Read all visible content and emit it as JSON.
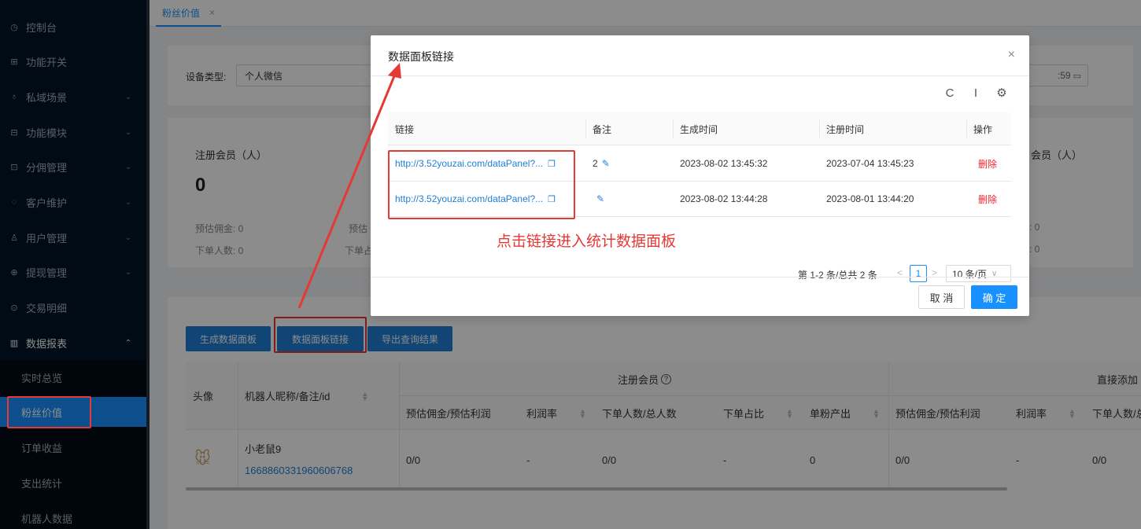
{
  "sidebar": {
    "items": [
      {
        "icon": "dashboard-icon",
        "glyph": "◷",
        "label": "控制台",
        "arrow": ""
      },
      {
        "icon": "switch-icon",
        "glyph": "⊞",
        "label": "功能开关",
        "arrow": ""
      },
      {
        "icon": "scene-icon",
        "glyph": "♁",
        "label": "私域场景",
        "arrow": "⌄"
      },
      {
        "icon": "module-icon",
        "glyph": "⊟",
        "label": "功能模块",
        "arrow": "⌄"
      },
      {
        "icon": "commission-icon",
        "glyph": "⊡",
        "label": "分佣管理",
        "arrow": "⌄"
      },
      {
        "icon": "customer-icon",
        "glyph": "◌",
        "label": "客户维护",
        "arrow": "⌄"
      },
      {
        "icon": "user-icon",
        "glyph": "♙",
        "label": "用户管理",
        "arrow": "⌄"
      },
      {
        "icon": "withdraw-icon",
        "glyph": "⊕",
        "label": "提现管理",
        "arrow": "⌄"
      },
      {
        "icon": "transaction-icon",
        "glyph": "⊙",
        "label": "交易明细",
        "arrow": ""
      },
      {
        "icon": "report-icon",
        "glyph": "▥",
        "label": "数据报表",
        "arrow": "⌃"
      }
    ],
    "sub_items": [
      "实时总览",
      "粉丝价值",
      "订单收益",
      "支出统计",
      "机器人数据"
    ]
  },
  "tabbar": {
    "tab_label": "粉丝价值",
    "close": "×"
  },
  "filter": {
    "device_label": "设备类型:",
    "device_value": "个人微信",
    "date_suffix": ":59"
  },
  "stats": {
    "left_title": "注册会员（人）",
    "left_value": "0",
    "left_sub1": "预估佣金: 0",
    "left_sub2": "下单人数: 0",
    "mid_sub1": "预估",
    "mid_sub2": "下单占",
    "right_title": "会员（人）",
    "right_sub1": ": 0",
    "right_sub2": ": 0"
  },
  "actions": {
    "generate": "生成数据面板",
    "panel_link": "数据面板链接",
    "export": "导出查询结果"
  },
  "table": {
    "col_avatar": "头像",
    "col_robot": "机器人昵称/备注/id",
    "group_registered": "注册会员",
    "group_direct": "直接添加",
    "sub_headers": [
      "预估佣金/预估利润",
      "利润率",
      "下单人数/总人数",
      "下单占比",
      "单粉产出",
      "预估佣金/预估利润",
      "利润率",
      "下单人数/总"
    ],
    "row": {
      "name": "小老鼠9",
      "id": "1668860331960606768",
      "cells": [
        "0/0",
        "-",
        "0/0",
        "-",
        "0",
        "0/0",
        "-",
        "0/0"
      ]
    }
  },
  "modal": {
    "title": "数据面板链接",
    "close": "×",
    "tools": {
      "refresh": "C",
      "density": "I",
      "settings": "⚙"
    },
    "headers": [
      "链接",
      "备注",
      "生成时间",
      "注册时间",
      "操作"
    ],
    "rows": [
      {
        "link": "http://3.52youzai.com/dataPanel?...",
        "note": "2",
        "created": "2023-08-02 13:45:32",
        "registered": "2023-07-04 13:45:23",
        "action": "删除"
      },
      {
        "link": "http://3.52youzai.com/dataPanel?...",
        "note": "",
        "created": "2023-08-02 13:44:28",
        "registered": "2023-08-01 13:44:20",
        "action": "删除"
      }
    ],
    "annotation": "点击链接进入统计数据面板",
    "pager": {
      "summary": "第 1-2 条/总共 2 条",
      "prev": "<",
      "page": "1",
      "next": ">",
      "size": "10 条/页",
      "size_arrow": "∨"
    },
    "cancel": "取 消",
    "ok": "确 定"
  },
  "colors": {
    "accent": "#1890ff",
    "annotation_red": "#e53935",
    "sidebar_bg": "#001529"
  }
}
